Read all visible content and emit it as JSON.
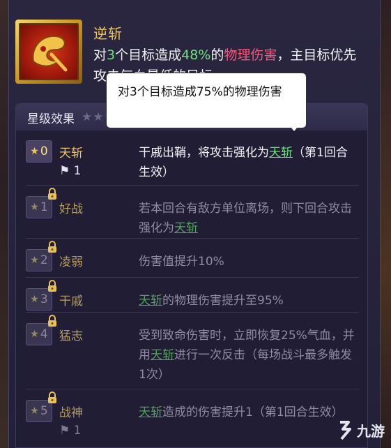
{
  "skill": {
    "name": "逆斩",
    "desc_parts": [
      {
        "t": "对",
        "c": ""
      },
      {
        "t": "3",
        "c": "g"
      },
      {
        "t": "个目标造成",
        "c": ""
      },
      {
        "t": "48%",
        "c": "g"
      },
      {
        "t": "的",
        "c": ""
      },
      {
        "t": "物理伤害",
        "c": "r"
      },
      {
        "t": "，主目标优先攻击气血最低的目标",
        "c": ""
      }
    ]
  },
  "tooltip": {
    "text": "对3个目标造成75%的物理伤害"
  },
  "star_effects": {
    "title": "星级效果",
    "rows": [
      {
        "level": "0",
        "name": "天斩",
        "locked": false,
        "flag": "1",
        "effect_parts": [
          {
            "t": "干戚出鞘，将攻击强化为",
            "c": ""
          },
          {
            "t": "天斩",
            "c": "link"
          },
          {
            "t": "（第1回合生效）",
            "c": ""
          }
        ]
      },
      {
        "level": "1",
        "name": "好战",
        "locked": true,
        "flag": "",
        "effect_parts": [
          {
            "t": "若本回合有敌方单位离场，则下回合攻击强化为",
            "c": ""
          },
          {
            "t": "天斩",
            "c": "link"
          }
        ]
      },
      {
        "level": "2",
        "name": "凌弱",
        "locked": true,
        "flag": "",
        "effect_parts": [
          {
            "t": "伤害值提升10%",
            "c": ""
          }
        ]
      },
      {
        "level": "3",
        "name": "干戚",
        "locked": true,
        "flag": "",
        "effect_parts": [
          {
            "t": "天斩",
            "c": "link"
          },
          {
            "t": "的物理伤害提升至95%",
            "c": ""
          }
        ]
      },
      {
        "level": "4",
        "name": "猛志",
        "locked": true,
        "flag": "",
        "effect_parts": [
          {
            "t": "受到致命伤害时，立即恢复25%气血，并用",
            "c": ""
          },
          {
            "t": "天斩",
            "c": "link"
          },
          {
            "t": "进行一次反击（每场战斗最多触发1次）",
            "c": ""
          }
        ]
      },
      {
        "level": "5",
        "name": "战神",
        "locked": true,
        "flag": "1",
        "effect_parts": [
          {
            "t": "天斩",
            "c": "link"
          },
          {
            "t": "造成的伤害提升1",
            "c": ""
          },
          {
            "t": "（第1回合生效）",
            "c": ""
          }
        ]
      }
    ]
  },
  "watermark": {
    "text": "九游"
  },
  "colors": {
    "accent_gold": "#f1c65a",
    "highlight_green": "#6ee07a",
    "damage_pink": "#f25a78"
  }
}
